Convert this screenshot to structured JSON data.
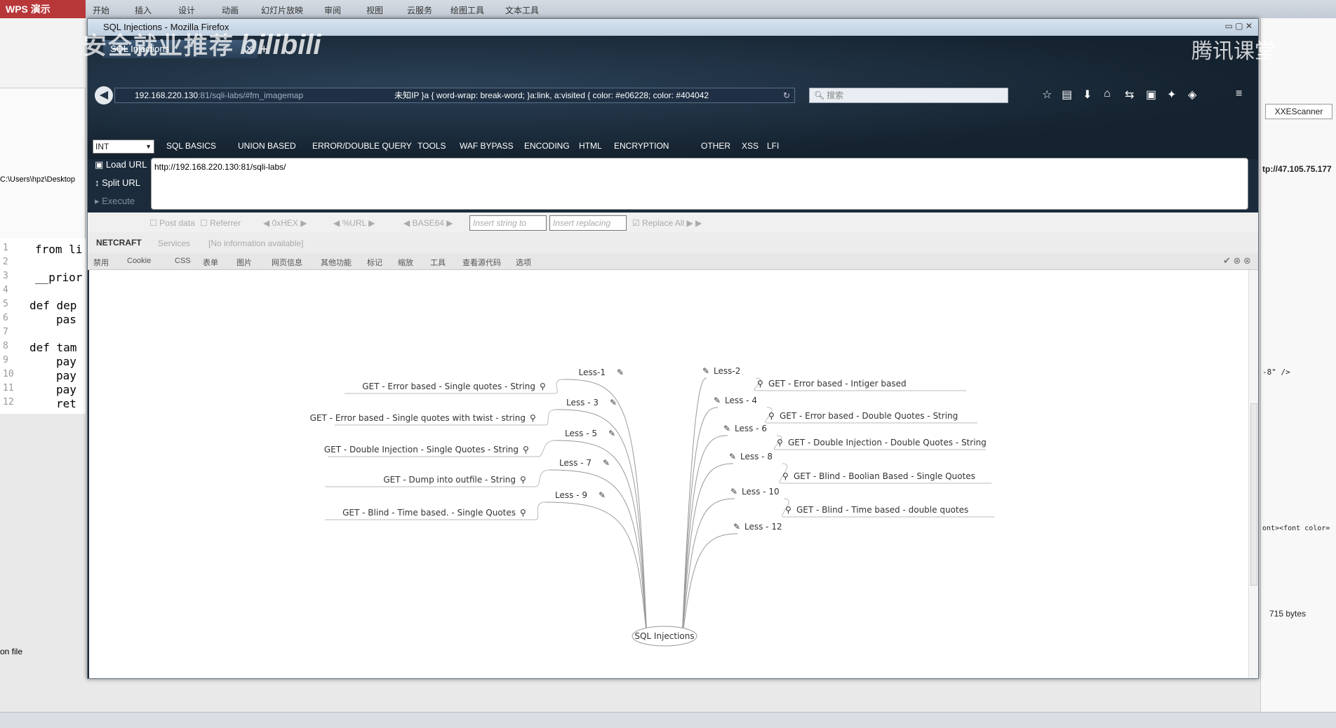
{
  "background_app": {
    "name": "WPS 演示",
    "menu": [
      "开始",
      "插入",
      "设计",
      "动画",
      "幻灯片放映",
      "审阅",
      "视图",
      "云服务",
      "绘图工具",
      "文本工具"
    ],
    "path_fragment": "C:\\Users\\hpz\\Desktop",
    "code_lines": [
      {
        "n": "1",
        "text": "from li"
      },
      {
        "n": "2",
        "text": ""
      },
      {
        "n": "3",
        "text": "__prior"
      },
      {
        "n": "4",
        "text": ""
      },
      {
        "n": "5",
        "text": "def dep"
      },
      {
        "n": "6",
        "text": "pas"
      },
      {
        "n": "7",
        "text": ""
      },
      {
        "n": "8",
        "text": "def tam"
      },
      {
        "n": "9",
        "text": "pay"
      },
      {
        "n": "10",
        "text": "pay"
      },
      {
        "n": "11",
        "text": "pay"
      },
      {
        "n": "12",
        "text": "ret"
      }
    ],
    "right_panel": {
      "xxe_button": "XXEScanner",
      "url_fragment": "tp://47.105.75.177",
      "code_fragment": "-8\" />",
      "html_fragment": "ont><font color=",
      "bytes": "715 bytes"
    },
    "statusbar_fragment": "on file"
  },
  "watermark": {
    "left": "安全就业推荐",
    "bili": "bilibili",
    "right": "腾讯课堂"
  },
  "browser": {
    "window_title": "SQL Injections - Mozilla Firefox",
    "tab_title": "SQL Injections",
    "url_host": "192.168.220.130",
    "url_path": ":81/sqli-labs/#fm_imagemap",
    "url_overlay": "未知IP   }a { word-wrap: break-word; }a:link, a:visited { color: #e06228; color: #404042",
    "search_placeholder": "搜索"
  },
  "hackbar": {
    "select_value": "INT",
    "menu": [
      "SQL BASICS",
      "UNION BASED",
      "ERROR/DOUBLE QUERY",
      "TOOLS",
      "WAF BYPASS",
      "ENCODING",
      "HTML",
      "ENCRYPTION",
      "OTHER",
      "XSS",
      "LFI"
    ],
    "load_url": "Load URL",
    "split_url": "Split URL",
    "execute": "Execute",
    "url_value": "http://192.168.220.130:81/sqli-labs/",
    "post_data": "Post data",
    "referrer": "Referrer",
    "hex": "0xHEX",
    "urlenc": "%URL",
    "base64": "BASE64",
    "replace_placeholder": "Insert string to replace",
    "replacing_placeholder": "Insert replacing string",
    "replace_all": "Replace All"
  },
  "netcraft": {
    "logo": "NETCRAFT",
    "services": "Services",
    "info": "[No information available]"
  },
  "webdev_toolbar": [
    "禁用",
    "Cookie",
    "CSS",
    "表单",
    "图片",
    "网页信息",
    "其他功能",
    "标记",
    "缩放",
    "工具",
    "查看源代码",
    "选项"
  ],
  "mindmap": {
    "center": "SQL Injections",
    "left": [
      {
        "less": "Less-1",
        "desc": "GET - Error based - Single quotes - String"
      },
      {
        "less": "Less - 3",
        "desc": "GET - Error based - Single quotes with twist - string"
      },
      {
        "less": "Less - 5",
        "desc": "GET - Double Injection - Single Quotes - String"
      },
      {
        "less": "Less - 7",
        "desc": "GET - Dump into outfile - String"
      },
      {
        "less": "Less - 9",
        "desc": "GET - Blind - Time based. -  Single Quotes"
      }
    ],
    "right": [
      {
        "less": "Less-2",
        "desc": "GET - Error based - Intiger based"
      },
      {
        "less": "Less - 4",
        "desc": "GET - Error based - Double Quotes - String"
      },
      {
        "less": "Less - 6",
        "desc": "GET - Double Injection - Double Quotes - String"
      },
      {
        "less": "Less - 8",
        "desc": "GET - Blind - Boolian Based - Single Quotes"
      },
      {
        "less": "Less - 10",
        "desc": "GET - Blind - Time based - double quotes"
      },
      {
        "less": "Less - 12",
        "desc": ""
      }
    ]
  }
}
